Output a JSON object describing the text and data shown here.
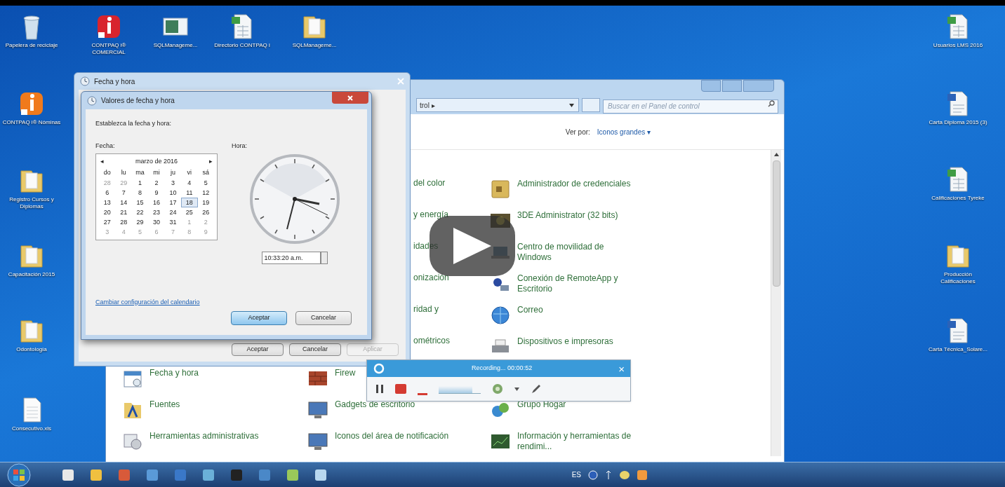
{
  "desktop_icons": [
    {
      "kind": "recycle",
      "label": "Papelera de reciclaje"
    },
    {
      "kind": "app-red",
      "label": "CONTPAQ i® COMERCIAL"
    },
    {
      "kind": "window",
      "label": "SQLManageme..."
    },
    {
      "kind": "spreadsheet",
      "label": "Directorio CONTPAQ i"
    },
    {
      "kind": "folder",
      "label": "SQLManageme..."
    },
    {
      "kind": "app-orange",
      "label": "CONTPAQ i® Nóminas"
    },
    {
      "kind": "folder",
      "label": "Registro Cursos y Diplomas"
    },
    {
      "kind": "folder",
      "label": "Capacitación 2015"
    },
    {
      "kind": "folder",
      "label": "Odontología"
    },
    {
      "kind": "document",
      "label": "Consecutivo.xls"
    },
    {
      "kind": "spreadsheet",
      "label": "Usuarios LMS 2016"
    },
    {
      "kind": "word",
      "label": "Carta Diploma 2015 (3)"
    },
    {
      "kind": "spreadsheet",
      "label": "Calificaciones Tyreke"
    },
    {
      "kind": "folder",
      "label": "Producción Calificaciones"
    },
    {
      "kind": "word",
      "label": "Carta Técnica_Solare..."
    }
  ],
  "control_panel": {
    "address": "trol ▸",
    "search": {
      "placeholder": "Buscar en el Panel de control"
    },
    "view_by_label": "Ver por:",
    "view_by_value": "Iconos grandes ▾",
    "rows": [
      {
        "items": [
          {
            "kind": "partial",
            "label": "del color"
          },
          {
            "kind": "credentials",
            "label": "Administrador de credenciales"
          }
        ]
      },
      {
        "items": [
          {
            "kind": "partial",
            "label": "y energía"
          },
          {
            "kind": "app",
            "label": "3DE Administrator (32 bits)"
          }
        ]
      },
      {
        "items": [
          {
            "kind": "partial",
            "label": "idades"
          },
          {
            "kind": "mobility",
            "label": "Centro de movilidad de Windows"
          }
        ]
      },
      {
        "items": [
          {
            "kind": "partial",
            "label": "onización"
          },
          {
            "kind": "remote",
            "label": "Conexión de RemoteApp y Escritorio"
          }
        ]
      },
      {
        "items": [
          {
            "kind": "partial",
            "label": "ridad y"
          },
          {
            "kind": "mail",
            "label": "Correo"
          }
        ]
      },
      {
        "items": [
          {
            "kind": "partial",
            "label": "ométricos"
          },
          {
            "kind": "printer",
            "label": "Dispositivos e impresoras"
          }
        ]
      },
      {
        "items": [
          {
            "kind": "calendar",
            "label": "Fecha y hora"
          },
          {
            "kind": "firewall",
            "label": "Firew"
          }
        ]
      },
      {
        "items": [
          {
            "kind": "fonts",
            "label": "Fuentes"
          },
          {
            "kind": "monitor",
            "label": "Gadgets de escritorio"
          },
          {
            "kind": "homegroup",
            "label": "Grupo Hogar"
          }
        ]
      },
      {
        "items": [
          {
            "kind": "tools",
            "label": "Herramientas administrativas"
          },
          {
            "kind": "monitor",
            "label": "Iconos del área de notificación"
          },
          {
            "kind": "perf",
            "label": "Información y herramientas de rendimi..."
          }
        ]
      }
    ]
  },
  "date_time_window": {
    "title": "Fecha y hora",
    "buttons": [
      {
        "label": "Aceptar",
        "disabled": false
      },
      {
        "label": "Cancelar",
        "disabled": false
      },
      {
        "label": "Aplicar",
        "disabled": true
      }
    ]
  },
  "date_time_dialog": {
    "title": "Valores de fecha y hora",
    "instruction": "Establezca la fecha y hora:",
    "date_label": "Fecha:",
    "time_label": "Hora:",
    "calendar": {
      "prev": "◂",
      "month": "marzo de 2016",
      "next": "▸",
      "weekdays": [
        "do",
        "lu",
        "ma",
        "mi",
        "ju",
        "vi",
        "sá"
      ],
      "days": [
        {
          "text": "28",
          "in_month": false,
          "selected": false
        },
        {
          "text": "29",
          "in_month": false,
          "selected": false
        },
        {
          "text": "1",
          "in_month": true,
          "selected": false
        },
        {
          "text": "2",
          "in_month": true,
          "selected": false
        },
        {
          "text": "3",
          "in_month": true,
          "selected": false
        },
        {
          "text": "4",
          "in_month": true,
          "selected": false
        },
        {
          "text": "5",
          "in_month": true,
          "selected": false
        },
        {
          "text": "6",
          "in_month": true,
          "selected": false
        },
        {
          "text": "7",
          "in_month": true,
          "selected": false
        },
        {
          "text": "8",
          "in_month": true,
          "selected": false
        },
        {
          "text": "9",
          "in_month": true,
          "selected": false
        },
        {
          "text": "10",
          "in_month": true,
          "selected": false
        },
        {
          "text": "11",
          "in_month": true,
          "selected": false
        },
        {
          "text": "12",
          "in_month": true,
          "selected": false
        },
        {
          "text": "13",
          "in_month": true,
          "selected": false
        },
        {
          "text": "14",
          "in_month": true,
          "selected": false
        },
        {
          "text": "15",
          "in_month": true,
          "selected": false
        },
        {
          "text": "16",
          "in_month": true,
          "selected": false
        },
        {
          "text": "17",
          "in_month": true,
          "selected": false
        },
        {
          "text": "18",
          "in_month": true,
          "selected": true
        },
        {
          "text": "19",
          "in_month": true,
          "selected": false
        },
        {
          "text": "20",
          "in_month": true,
          "selected": false
        },
        {
          "text": "21",
          "in_month": true,
          "selected": false
        },
        {
          "text": "22",
          "in_month": true,
          "selected": false
        },
        {
          "text": "23",
          "in_month": true,
          "selected": false
        },
        {
          "text": "24",
          "in_month": true,
          "selected": false
        },
        {
          "text": "25",
          "in_month": true,
          "selected": false
        },
        {
          "text": "26",
          "in_month": true,
          "selected": false
        },
        {
          "text": "27",
          "in_month": true,
          "selected": false
        },
        {
          "text": "28",
          "in_month": true,
          "selected": false
        },
        {
          "text": "29",
          "in_month": true,
          "selected": false
        },
        {
          "text": "30",
          "in_month": true,
          "selected": false
        },
        {
          "text": "31",
          "in_month": true,
          "selected": false
        },
        {
          "text": "1",
          "in_month": false,
          "selected": false
        },
        {
          "text": "2",
          "in_month": false,
          "selected": false
        },
        {
          "text": "3",
          "in_month": false,
          "selected": false
        },
        {
          "text": "4",
          "in_month": false,
          "selected": false
        },
        {
          "text": "5",
          "in_month": false,
          "selected": false
        },
        {
          "text": "6",
          "in_month": false,
          "selected": false
        },
        {
          "text": "7",
          "in_month": false,
          "selected": false
        },
        {
          "text": "8",
          "in_month": false,
          "selected": false
        },
        {
          "text": "9",
          "in_month": false,
          "selected": false
        }
      ]
    },
    "time_value": "10:33:20 a.m.",
    "link": "Cambiar configuración del calendario",
    "buttons": [
      {
        "label": "Aceptar",
        "focused": true
      },
      {
        "label": "Cancelar",
        "focused": false
      }
    ]
  },
  "recorder": {
    "title": "Recording... 00:00:52",
    "close": "×",
    "volume": {
      "level": 0.8
    }
  },
  "taskbar": {
    "language": "ES"
  }
}
